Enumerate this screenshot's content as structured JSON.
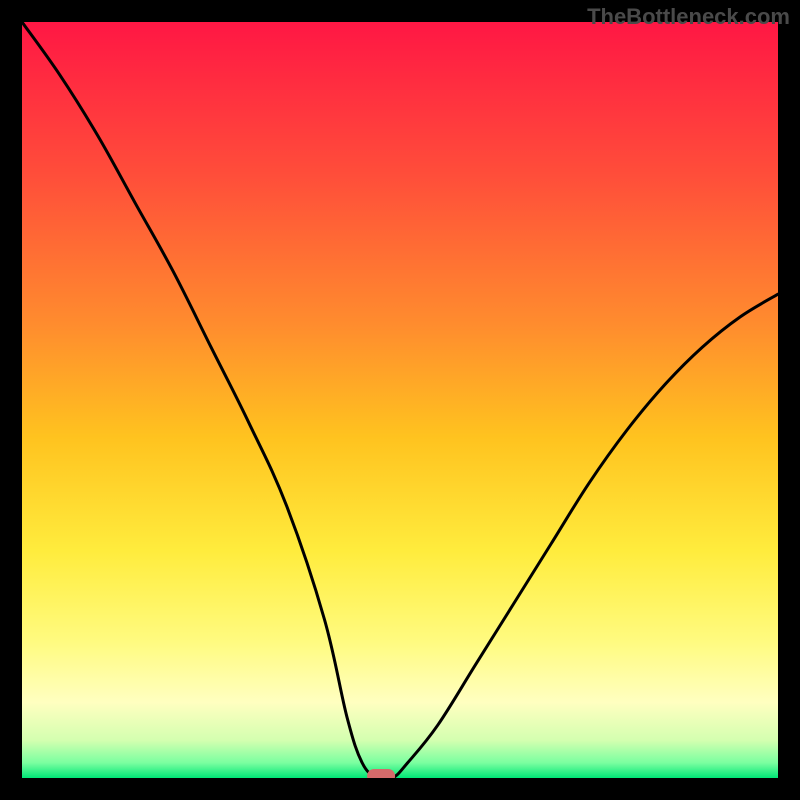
{
  "watermark": "TheBottleneck.com",
  "chart_data": {
    "type": "line",
    "title": "",
    "xlabel": "",
    "ylabel": "",
    "xlim": [
      0,
      100
    ],
    "ylim": [
      0,
      100
    ],
    "optimal_x": 47,
    "series": [
      {
        "name": "bottleneck-curve",
        "x": [
          0,
          5,
          10,
          15,
          20,
          25,
          30,
          35,
          40,
          43,
          45,
          47,
          49,
          51,
          55,
          60,
          65,
          70,
          75,
          80,
          85,
          90,
          95,
          100
        ],
        "y": [
          100,
          93,
          85,
          76,
          67,
          57,
          47,
          36,
          21,
          8,
          2,
          0,
          0,
          2,
          7,
          15,
          23,
          31,
          39,
          46,
          52,
          57,
          61,
          64
        ]
      }
    ],
    "marker": {
      "x": 47.5,
      "y": 0,
      "color": "#d46a6a"
    },
    "gradient_stops": [
      {
        "offset": 0,
        "color": "#ff1744"
      },
      {
        "offset": 20,
        "color": "#ff4d3a"
      },
      {
        "offset": 40,
        "color": "#ff8c2e"
      },
      {
        "offset": 55,
        "color": "#ffc31f"
      },
      {
        "offset": 70,
        "color": "#ffec3d"
      },
      {
        "offset": 82,
        "color": "#fffb80"
      },
      {
        "offset": 90,
        "color": "#ffffc0"
      },
      {
        "offset": 95,
        "color": "#d4ffb0"
      },
      {
        "offset": 98,
        "color": "#7affa0"
      },
      {
        "offset": 100,
        "color": "#00e676"
      }
    ]
  }
}
